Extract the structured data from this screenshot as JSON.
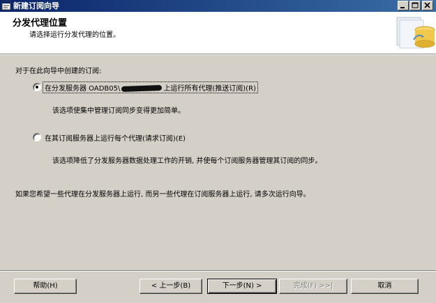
{
  "window": {
    "title": "新建订阅向导"
  },
  "header": {
    "title": "分发代理位置",
    "subtitle": "请选择运行分发代理的位置。"
  },
  "main": {
    "question": "对于在此向导中创建的订阅:",
    "options": [
      {
        "label_prefix": "在分发服务器 OADB05\\",
        "label_suffix": "上运行所有代理(推送订阅)(R)",
        "description": "该选项使集中管理订阅同步变得更加简单。",
        "selected": true
      },
      {
        "label": "在其订阅服务器上运行每个代理(请求订阅)(E)",
        "description": "该选项降低了分发服务器数据处理工作的开销, 并使每个订阅服务器管理其订阅的同步。",
        "selected": false
      }
    ],
    "note": "如果您希望一些代理在分发服务器上运行, 而另一些代理在订阅服务器上运行, 请多次运行向导。"
  },
  "buttons": {
    "help": "帮助(H)",
    "back": "< 上一步(B)",
    "next": "下一步(N) >",
    "finish": "完成(F) >>|",
    "cancel": "取消"
  }
}
